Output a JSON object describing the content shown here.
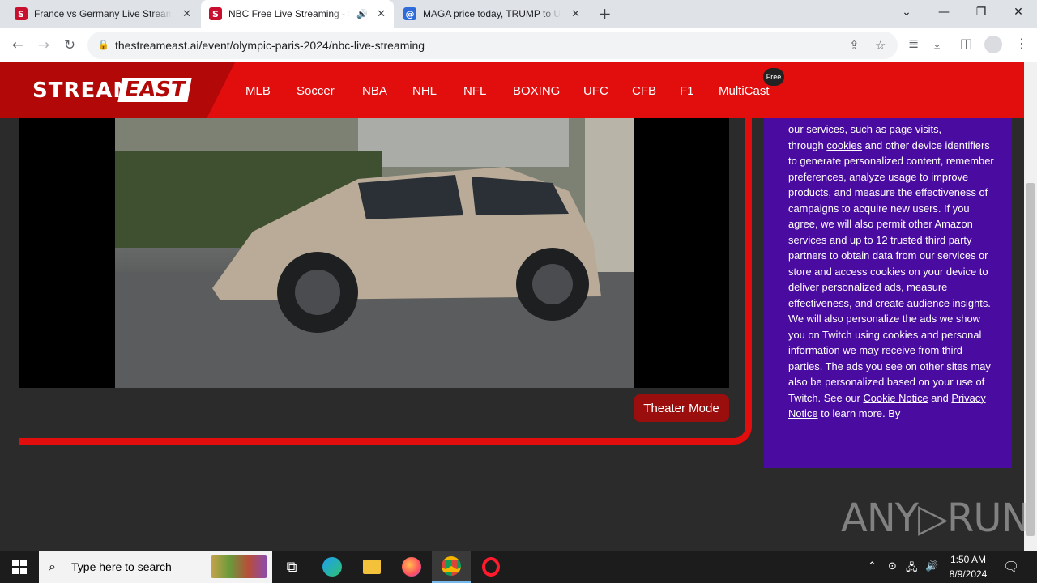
{
  "browser": {
    "tabs": [
      {
        "title": "France vs Germany Live Streamin",
        "favicon_color": "#c8102e",
        "favicon_letter": "S"
      },
      {
        "title": "NBC Free Live Streaming - S",
        "favicon_color": "#c8102e",
        "favicon_letter": "S"
      },
      {
        "title": "MAGA price today, TRUMP to US",
        "favicon_color": "#2f6bd9",
        "favicon_letter": "@"
      }
    ],
    "address": "thestreameast.ai/event/olympic-paris-2024/nbc-live-streaming"
  },
  "site": {
    "logo_left": "STREAM",
    "logo_right": "EAST",
    "nav": [
      "MLB",
      "Soccer",
      "NBA",
      "NHL",
      "NFL",
      "BOXING",
      "UFC",
      "CFB",
      "F1",
      "MultiCast"
    ],
    "free_badge": "Free",
    "theater_button": "Theater Mode"
  },
  "consent": {
    "line0": "our services, such as page visits,",
    "line1_prefix": "through ",
    "cookies_link": "cookies",
    "line1_suffix": " and other device",
    "body": "identifiers to generate personalized content, remember preferences, analyze usage to improve products, and measure the effectiveness of campaigns to acquire new users. If you agree, we will also permit other Amazon services and up to 12 trusted third party partners to obtain data from our services or store and access cookies on your device to deliver personalized ads, measure effectiveness, and create audience insights. We will also personalize the ads we show you on Twitch using cookies and personal information we may receive from third parties. The ads you see on other sites may also be personalized based on your use of Twitch. See our ",
    "cookie_notice_link": "Cookie Notice",
    "and_text": " and",
    "privacy_link": "Privacy Notice",
    "tail": " to learn more. By"
  },
  "watermark": "ANY▷RUN",
  "taskbar": {
    "search_placeholder": "Type here to search",
    "time": "1:50 AM",
    "date": "8/9/2024"
  },
  "colors": {
    "brand_red": "#e20d0d",
    "panel_purple": "#4a0ba0",
    "button_dark_red": "#9b0e0e"
  }
}
